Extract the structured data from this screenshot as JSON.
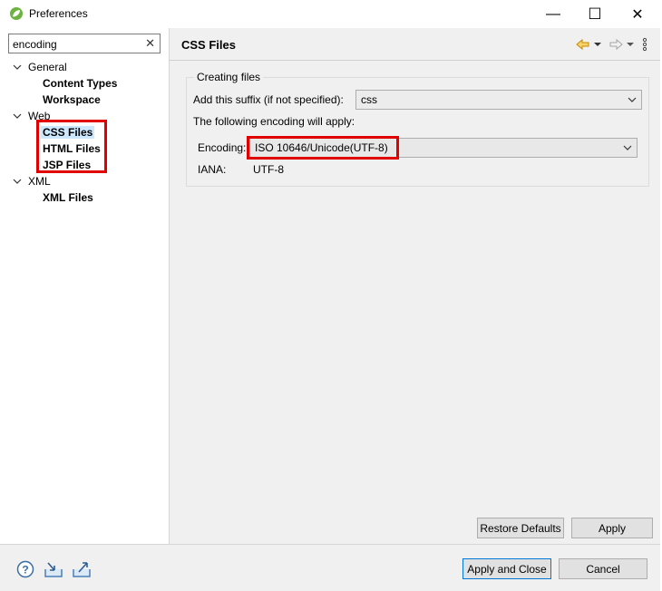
{
  "window": {
    "title": "Preferences",
    "minimize_symbol": "—",
    "maximize_symbol": "☐",
    "close_symbol": "✕"
  },
  "filter": {
    "value": "encoding",
    "clear_symbol": "✕"
  },
  "tree": {
    "general": {
      "label": "General",
      "children": [
        "Content Types",
        "Workspace"
      ]
    },
    "web": {
      "label": "Web",
      "children": [
        "CSS Files",
        "HTML Files",
        "JSP Files"
      ],
      "selected": "CSS Files"
    },
    "xml": {
      "label": "XML",
      "children": [
        "XML Files"
      ]
    }
  },
  "page": {
    "title": "CSS Files",
    "group_label": "Creating files",
    "suffix_label": "Add this suffix (if not specified):",
    "suffix_value": "css",
    "encoding_intro": "The following encoding will apply:",
    "encoding_label": "Encoding:",
    "encoding_value": "ISO 10646/Unicode(UTF-8)",
    "iana_label": "IANA:",
    "iana_value": "UTF-8",
    "restore_defaults": "Restore Defaults",
    "apply": "Apply"
  },
  "footer": {
    "apply_and_close": "Apply and Close",
    "cancel": "Cancel"
  },
  "colors": {
    "highlight_red": "#e00000",
    "selection_blue": "#cce8ff",
    "nav_arrow_yellow": "#e8a317"
  },
  "icons": [
    "spring-leaf-icon",
    "help-icon",
    "import-icon",
    "export-icon",
    "back-arrow-icon",
    "forward-arrow-icon",
    "view-menu-icon"
  ]
}
